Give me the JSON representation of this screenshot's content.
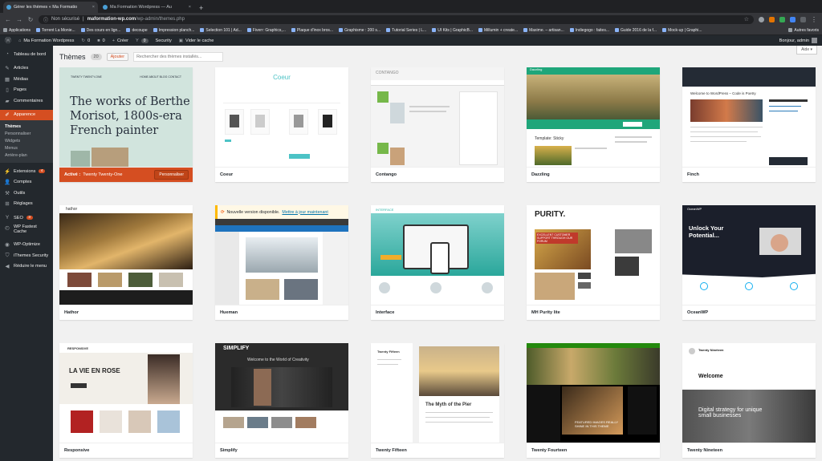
{
  "browser": {
    "tabs": [
      {
        "title": "Gérer les thèmes « Ma Formatio"
      },
      {
        "title": "Ma Formation Wordpress — Au"
      }
    ],
    "new_tab": "+",
    "insecure_label": "Non sécurisé",
    "url_host": "maformation-wp.com",
    "url_path": "/wp-admin/themes.php",
    "bookmarks": [
      "Applications",
      "Torrent La Monie...",
      "Des cours en lign...",
      "decoupe",
      "Impression planch...",
      "Selection 101 | Ad...",
      "Fiverr: Graphics,...",
      "Plaque d'inox bros...",
      "Graphisme : 200 s...",
      "Tutorial Series | L...",
      "UI Kits | GraphicB...",
      "Millumin + create...",
      "Maxime. – artisan...",
      "Indiegogo : faites...",
      "Guide 2016 de la f...",
      "Mock-up | Graphi..."
    ],
    "bookmarks_other": "Autres favoris"
  },
  "adminbar": {
    "site_name": "Ma Formation Wordpress",
    "updates": "0",
    "comments": "0",
    "new_label": "Créer",
    "security_badge": "0",
    "security_label": "Security",
    "cache_label": "Vider le cache",
    "greeting": "Bonjour, admin"
  },
  "sidebar": {
    "items": [
      {
        "icon": "dashboard-icon",
        "label": "Tableau de bord"
      },
      {
        "icon": "pin-icon",
        "label": "Articles"
      },
      {
        "icon": "media-icon",
        "label": "Médias"
      },
      {
        "icon": "page-icon",
        "label": "Pages"
      },
      {
        "icon": "comment-icon",
        "label": "Commentaires"
      },
      {
        "icon": "brush-icon",
        "label": "Apparence"
      }
    ],
    "appearance_sub": [
      "Thèmes",
      "Personnaliser",
      "Widgets",
      "Menus",
      "Arrière-plan"
    ],
    "items2": [
      {
        "icon": "plugin-icon",
        "label": "Extensions",
        "count": "4"
      },
      {
        "icon": "user-icon",
        "label": "Comptes"
      },
      {
        "icon": "wrench-icon",
        "label": "Outils"
      },
      {
        "icon": "settings-icon",
        "label": "Réglages"
      },
      {
        "icon": "seo-icon",
        "label": "SEO",
        "count": "3"
      },
      {
        "icon": "fastest-icon",
        "label": "WP Fastest Cache"
      },
      {
        "icon": "optimize-icon",
        "label": "WP-Optimize"
      },
      {
        "icon": "shield-icon",
        "label": "iThemes Security"
      },
      {
        "icon": "collapse-icon",
        "label": "Réduire le menu"
      }
    ]
  },
  "main": {
    "title": "Thèmes",
    "count": "20",
    "add_button": "Ajouter",
    "search_placeholder": "Rechercher des thèmes installés...",
    "help": "Aide ▾",
    "active_label": "Activé :",
    "customize_button": "Personnaliser",
    "update_notice": "Nouvelle version disponible.",
    "update_link": "Mettre à jour maintenant"
  },
  "themes": [
    {
      "name": "Twenty Twenty-One",
      "active": true
    },
    {
      "name": "Coeur"
    },
    {
      "name": "Contango"
    },
    {
      "name": "Dazzling"
    },
    {
      "name": "Finch"
    },
    {
      "name": "Hathor"
    },
    {
      "name": "Hueman",
      "update": true
    },
    {
      "name": "Interface"
    },
    {
      "name": "MH Purity lite"
    },
    {
      "name": "OceanWP"
    },
    {
      "name": "Responsive"
    },
    {
      "name": "Simplify"
    },
    {
      "name": "Twenty Fifteen"
    },
    {
      "name": "Twenty Fourteen"
    },
    {
      "name": "Twenty Nineteen"
    }
  ],
  "previews": {
    "t21_headline": "The works of Berthe Morisot, 1800s-era French painter",
    "t21_brand": "TWENTY TWENTY-ONE",
    "t21_nav": "HOME  ABOUT  BLOG  CONTACT",
    "coeur_logo": "Coeur",
    "contango_logo": "CONTANGO",
    "dazzling_logo": "Dazzling",
    "dazzling_widget": "Template: Sticky",
    "finch_banner": "Welcome to WordPress – Code is Poetry",
    "hathor_logo": "hathor",
    "interface_logo": "INTERFACE",
    "purity_logo": "PURITY.",
    "purity_banner": "EXCELLENT CUSTOMER SUPPORT THROUGH OUR FORUM",
    "ocean_logo": "OceanWP",
    "ocean_headline": "Unlock Your Potential...",
    "responsive_logo": "RESPONSIVE",
    "responsive_headline": "LA VIE EN ROSE",
    "simplify_logo": "SIMPLIFY",
    "simplify_headline": "Welcome to the World of Creativity",
    "fifteen_title": "The Myth of the Pier",
    "fifteen_site": "Twenty Fifteen",
    "fourteen_banner": "FEATURED IMAGES REALLY SHINE IN THIS THEME",
    "nineteen_site": "Twenty Nineteen",
    "nineteen_welcome": "Welcome",
    "nineteen_tagline": "Digital strategy for unique small businesses"
  },
  "colors": {
    "wp_orange": "#d54e21",
    "admin_dark": "#23282d",
    "t21_bg": "#d1e4dd",
    "dazzling_green": "#1fa67a",
    "contango_green": "#76b84a",
    "purity_red": "#c0392b"
  }
}
